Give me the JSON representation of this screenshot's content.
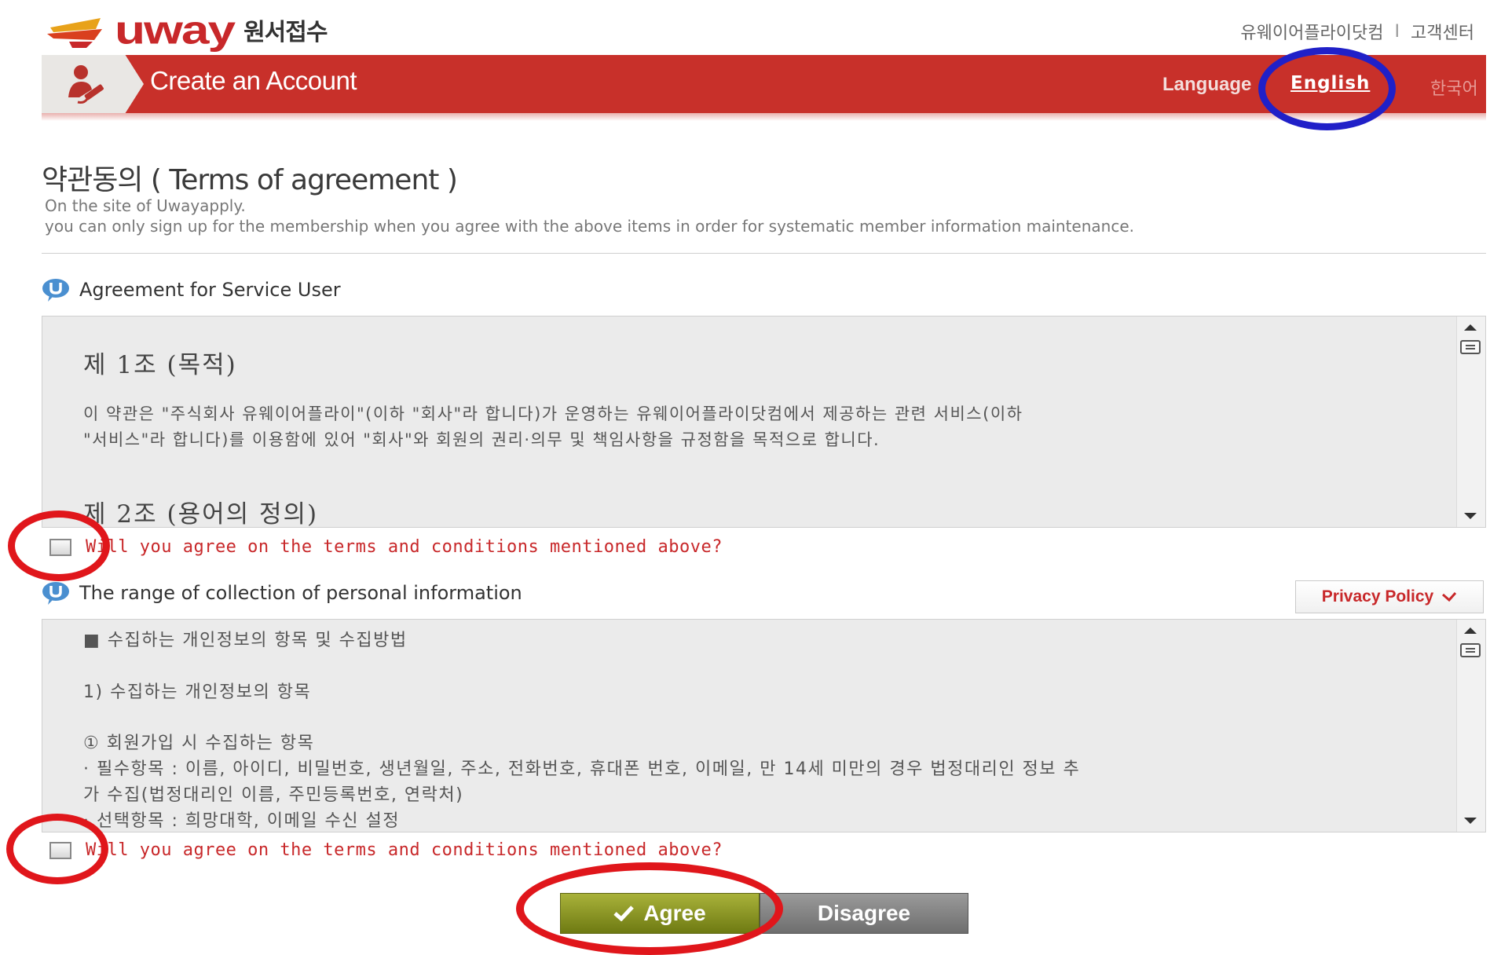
{
  "brand": {
    "name": "uway",
    "subtitle": "원서접수",
    "brand_color": "#c8282a"
  },
  "top_links": {
    "site": "유웨이어플라이닷컴",
    "separator": "I",
    "support": "고객센터"
  },
  "header": {
    "title": "Create an Account",
    "language_label": "Language",
    "english": "English",
    "korean": "한국어",
    "bar_color": "#c8302a"
  },
  "page": {
    "title": "약관동의 ( Terms of agreement )",
    "desc_line1": "On the site of Uwayapply.",
    "desc_line2": "you can only sign up for the membership when you agree with the above items in order for systematic member information maintenance."
  },
  "section1": {
    "heading": "Agreement for Service User",
    "article1_title": "제 1조 (목적)",
    "article1_line1": "이 약관은 \"주식회사 유웨이어플라이\"(이하 \"회사\"라 합니다)가 운영하는 유웨이어플라이닷컴에서 제공하는 관련 서비스(이하",
    "article1_line2": "\"서비스\"라 합니다)를 이용함에 있어 \"회사\"와 회원의 권리·의무 및 책임사항을 규정함을 목적으로 합니다.",
    "article2_title": "제 2조 (용어의 정의)",
    "agree_text": "Will you agree on the terms and conditions mentioned above?"
  },
  "section2": {
    "heading": "The range of collection of personal information",
    "privacy_button": "Privacy Policy",
    "line1": "■ 수집하는 개인정보의 항목 및 수집방법",
    "line2": "1) 수집하는 개인정보의 항목",
    "line3": "① 회원가입 시 수집하는 항목",
    "line4": "· 필수항목 : 이름, 아이디, 비밀번호, 생년월일, 주소, 전화번호, 휴대폰 번호, 이메일, 만 14세 미만의 경우 법정대리인 정보 추",
    "line5": "가 수집(법정대리인 이름, 주민등록번호, 연락처)",
    "line6": "· 선택항목 : 희망대학, 이메일 수신 설정",
    "agree_text": "Will you agree on the terms and conditions mentioned above?"
  },
  "buttons": {
    "agree": "Agree",
    "disagree": "Disagree"
  },
  "annotation_colors": {
    "blue_circle": "#2020c8",
    "red_circle": "#e0161b"
  }
}
